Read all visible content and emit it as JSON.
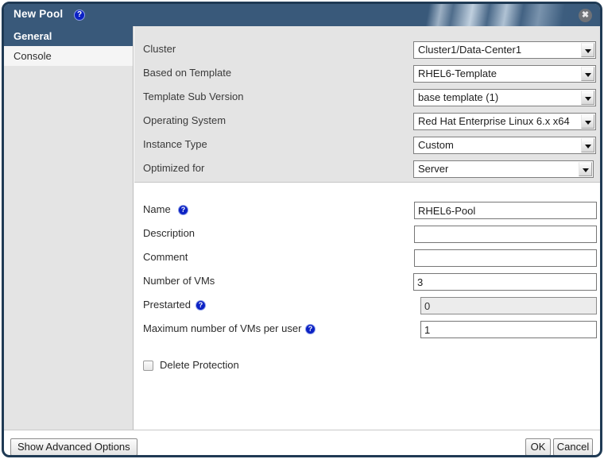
{
  "window": {
    "title": "New Pool",
    "help_icon": "help-icon",
    "close_icon": "✖"
  },
  "sidebar": {
    "items": [
      {
        "label": "General",
        "selected": true
      },
      {
        "label": "Console",
        "selected": false
      }
    ]
  },
  "form": {
    "top_section": [
      {
        "label": "Cluster",
        "value": "Cluster1/Data-Center1",
        "control": "combo"
      },
      {
        "label": "Based on Template",
        "value": "RHEL6-Template",
        "control": "combo"
      },
      {
        "label": "Template Sub Version",
        "value": "base template (1)",
        "control": "combo"
      },
      {
        "label": "Operating System",
        "value": "Red Hat Enterprise Linux 6.x x64",
        "control": "combo"
      },
      {
        "label": "Instance Type",
        "value": "Custom",
        "control": "combo"
      },
      {
        "label": "Optimized for",
        "value": "Server",
        "control": "combo"
      }
    ],
    "bottom_section": [
      {
        "label": "Name",
        "value": "RHEL6-Pool",
        "placeholder": "",
        "help": true,
        "disabled": false
      },
      {
        "label": "Description",
        "value": "",
        "placeholder": "",
        "help": false,
        "disabled": false
      },
      {
        "label": "Comment",
        "value": "",
        "placeholder": "",
        "help": false,
        "disabled": false
      },
      {
        "label": "Number of VMs",
        "value": "3",
        "placeholder": "",
        "help": false,
        "disabled": false
      },
      {
        "label": "Prestarted",
        "value": "0",
        "placeholder": "",
        "help": true,
        "disabled": true
      },
      {
        "label": "Maximum number of VMs per user",
        "value": "1",
        "placeholder": "",
        "help": true,
        "disabled": false
      }
    ],
    "delete_protection": {
      "label": "Delete Protection",
      "checked": false
    }
  },
  "footer": {
    "advanced_label": "Show Advanced Options",
    "ok_label": "OK",
    "cancel_label": "Cancel"
  },
  "colors": {
    "title_bar": "#39597a",
    "selected_item": "#39597a",
    "panel_grey": "#e4e4e4",
    "help_blue": "#0b21c4",
    "border_navy": "#1f3a54"
  }
}
